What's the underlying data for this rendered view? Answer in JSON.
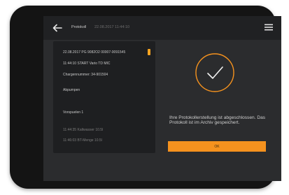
{
  "header": {
    "back_icon": "back-arrow-icon",
    "title": "Protokoll",
    "timestamp": "22.08.2017 11:44:10",
    "menu_icon": "hamburger-menu-icon"
  },
  "log": {
    "lines": [
      "22.08.2017 PG 9082O2 00007-0091545",
      "11:44:10 START Vario TD MIC",
      "Chargennummer: 34-901504",
      "Abpumpen",
      "Vorspuelen 1",
      "11:44:35 Kaltwasser 10.5l",
      "11:46:03 BT-Menge 10.5l"
    ]
  },
  "status": {
    "icon": "checkmark-circle-icon",
    "message": "Ihre Protokollerstellung ist abgeschlossen. Das Protokoll ist im Archiv gespeichert.",
    "ok_label": "OK"
  },
  "colors": {
    "accent": "#f5921e",
    "background": "#2b2c2e",
    "panel": "#1e1f21"
  }
}
